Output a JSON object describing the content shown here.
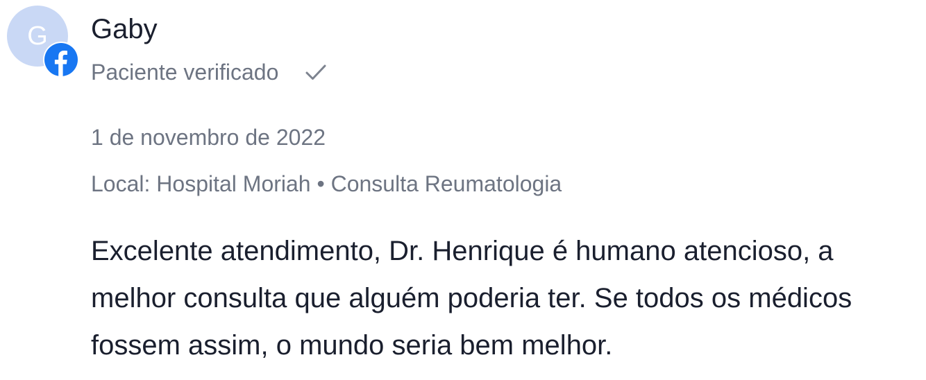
{
  "review": {
    "avatar_initial": "G",
    "badge_icon": "facebook-icon",
    "author_name": "Gaby",
    "verified_label": "Paciente verificado",
    "verified_icon": "check-icon",
    "date": "1 de novembro de 2022",
    "location": "Local: Hospital Moriah • Consulta Reumatologia",
    "text": "Excelente atendimento, Dr. Henrique é humano atencioso, a melhor consulta que alguém poderia ter. Se todos os médicos fossem assim, o mundo seria bem melhor."
  },
  "colors": {
    "avatar_bg": "#c9d8f5",
    "facebook_blue": "#1877f2",
    "text_primary": "#1a1f2e",
    "text_secondary": "#6d7482"
  }
}
